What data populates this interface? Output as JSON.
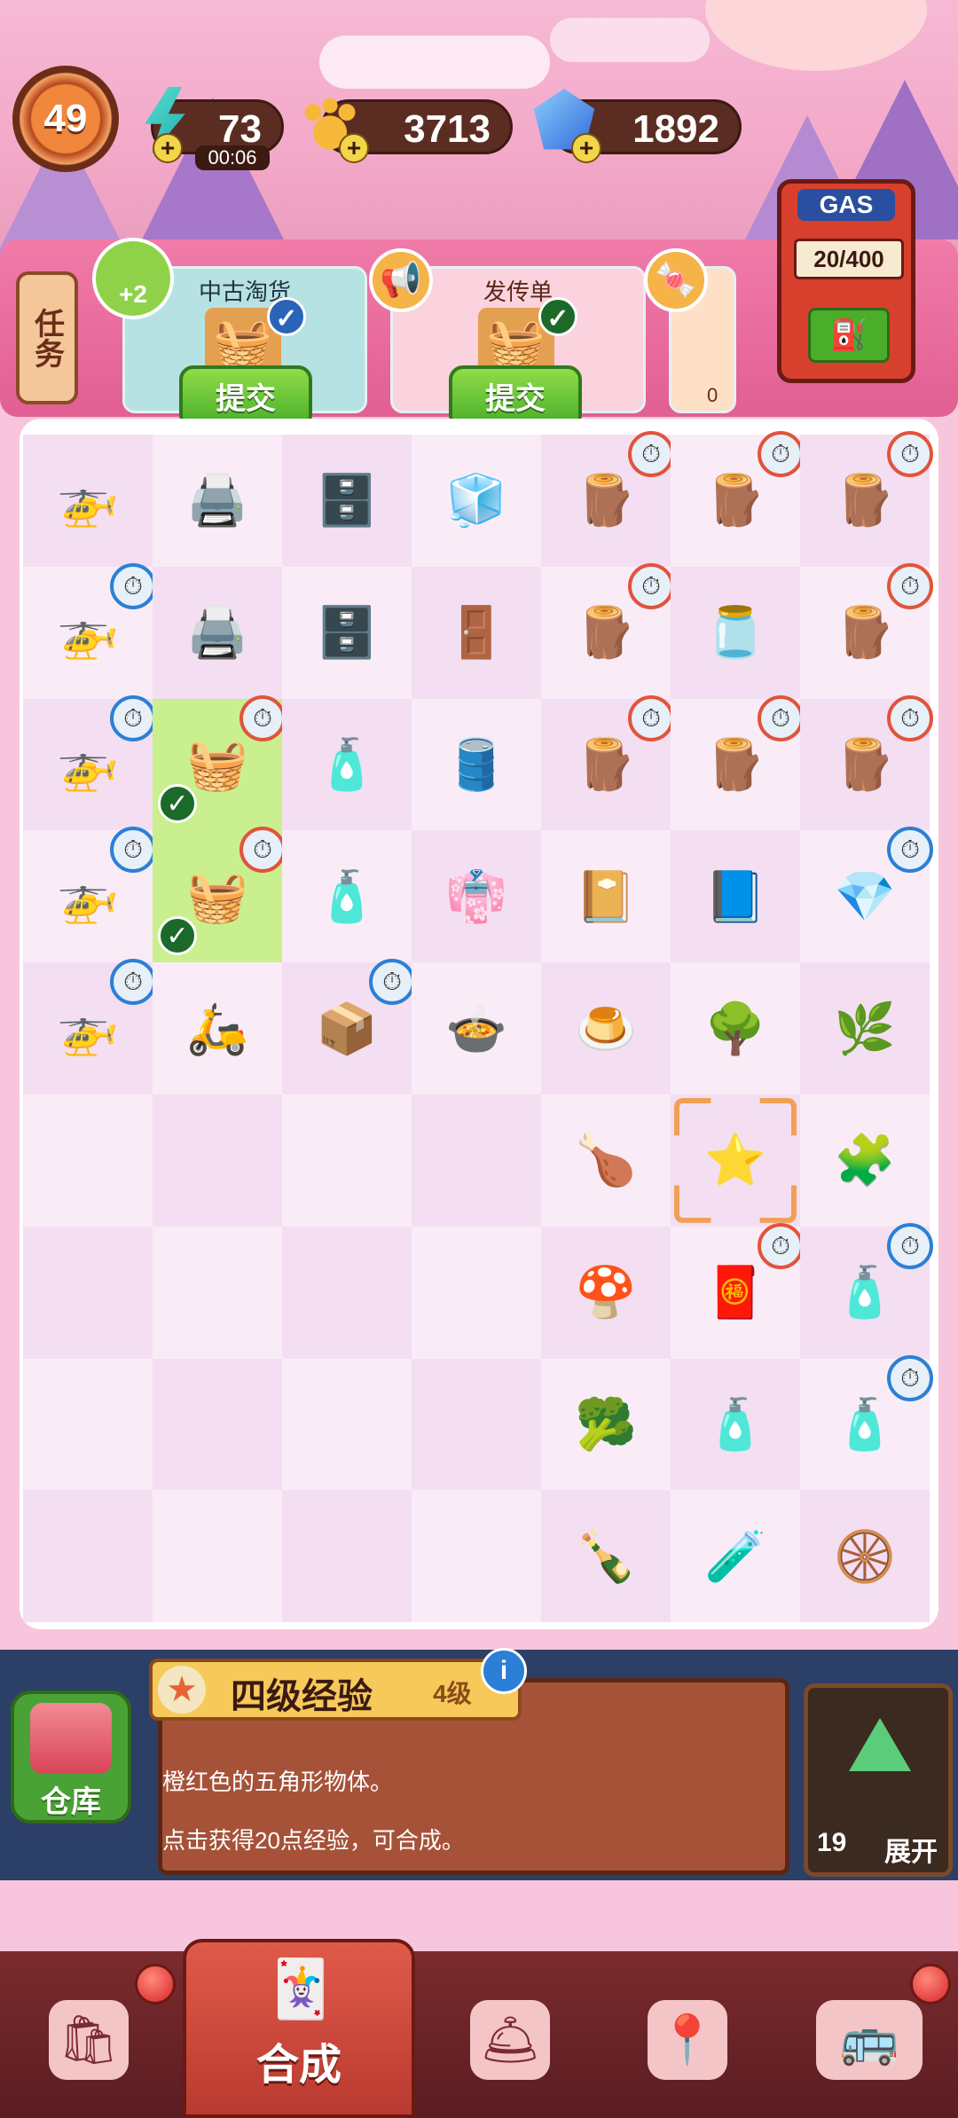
{
  "header": {
    "level": "49",
    "energy": {
      "value": "73",
      "timer": "00:06"
    },
    "paws": {
      "value": "3713"
    },
    "gems": {
      "value": "1892"
    },
    "gas": {
      "label": "GAS",
      "value": "20/400"
    }
  },
  "tasks": {
    "tab_label": "任务",
    "bonus": "+2",
    "cards": [
      {
        "title": "中古淘货",
        "button": "提交"
      },
      {
        "title": "发传单",
        "button": "提交"
      },
      {
        "title": "",
        "count": "0"
      }
    ]
  },
  "board": {
    "rows": [
      [
        {
          "i": "🚁",
          "t": ""
        },
        {
          "i": "🖨️",
          "t": ""
        },
        {
          "i": "🗄️",
          "t": ""
        },
        {
          "i": "🧊",
          "t": ""
        },
        {
          "i": "🪵",
          "t": "r"
        },
        {
          "i": "🪵",
          "t": "r"
        },
        {
          "i": "🪵",
          "t": "r"
        }
      ],
      [
        {
          "i": "🚁",
          "t": "b"
        },
        {
          "i": "🖨️",
          "t": ""
        },
        {
          "i": "🗄️",
          "t": ""
        },
        {
          "i": "🚪",
          "t": ""
        },
        {
          "i": "🪵",
          "t": "r"
        },
        {
          "i": "🫙",
          "t": ""
        },
        {
          "i": "🪵",
          "t": "r"
        }
      ],
      [
        {
          "i": "🚁",
          "t": "b"
        },
        {
          "i": "🧺",
          "t": "r",
          "g": true
        },
        {
          "i": "🧴",
          "t": ""
        },
        {
          "i": "🛢️",
          "t": ""
        },
        {
          "i": "🪵",
          "t": "r"
        },
        {
          "i": "🪵",
          "t": "r"
        },
        {
          "i": "🪵",
          "t": "r"
        }
      ],
      [
        {
          "i": "🚁",
          "t": "b"
        },
        {
          "i": "🧺",
          "t": "r",
          "g": true
        },
        {
          "i": "🧴",
          "t": ""
        },
        {
          "i": "👘",
          "t": ""
        },
        {
          "i": "📔",
          "t": ""
        },
        {
          "i": "📘",
          "t": ""
        },
        {
          "i": "💎",
          "t": "b"
        }
      ],
      [
        {
          "i": "🚁",
          "t": "b"
        },
        {
          "i": "🛵",
          "t": ""
        },
        {
          "i": "📦",
          "t": "b"
        },
        {
          "i": "🍲",
          "t": ""
        },
        {
          "i": "🍮",
          "t": ""
        },
        {
          "i": "🌳",
          "t": ""
        },
        {
          "i": "🌿",
          "t": ""
        }
      ],
      [
        {
          "i": "",
          "t": ""
        },
        {
          "i": "",
          "t": ""
        },
        {
          "i": "",
          "t": ""
        },
        {
          "i": "",
          "t": ""
        },
        {
          "i": "🍗",
          "t": ""
        },
        {
          "i": "⭐",
          "t": "",
          "s": true
        },
        {
          "i": "🧩",
          "t": ""
        }
      ],
      [
        {
          "i": "",
          "t": ""
        },
        {
          "i": "",
          "t": ""
        },
        {
          "i": "",
          "t": ""
        },
        {
          "i": "",
          "t": ""
        },
        {
          "i": "🍄",
          "t": ""
        },
        {
          "i": "🧧",
          "t": "r"
        },
        {
          "i": "🧴",
          "t": "b"
        }
      ],
      [
        {
          "i": "",
          "t": ""
        },
        {
          "i": "",
          "t": ""
        },
        {
          "i": "",
          "t": ""
        },
        {
          "i": "",
          "t": ""
        },
        {
          "i": "🥦",
          "t": ""
        },
        {
          "i": "🧴",
          "t": ""
        },
        {
          "i": "🧴",
          "t": "b"
        }
      ],
      [
        {
          "i": "",
          "t": ""
        },
        {
          "i": "",
          "t": ""
        },
        {
          "i": "",
          "t": ""
        },
        {
          "i": "",
          "t": ""
        },
        {
          "i": "🍾",
          "t": ""
        },
        {
          "i": "🧪",
          "t": ""
        },
        {
          "i": "🛞",
          "t": ""
        }
      ]
    ]
  },
  "info": {
    "storage_label": "仓库",
    "title": "四级经验",
    "level": "4级",
    "line1": "橙红色的五角形物体。",
    "line2": "点击获得20点经验，可合成。",
    "expand_count": "19",
    "expand_label": "展开"
  },
  "nav": {
    "merge_label": "合成"
  }
}
